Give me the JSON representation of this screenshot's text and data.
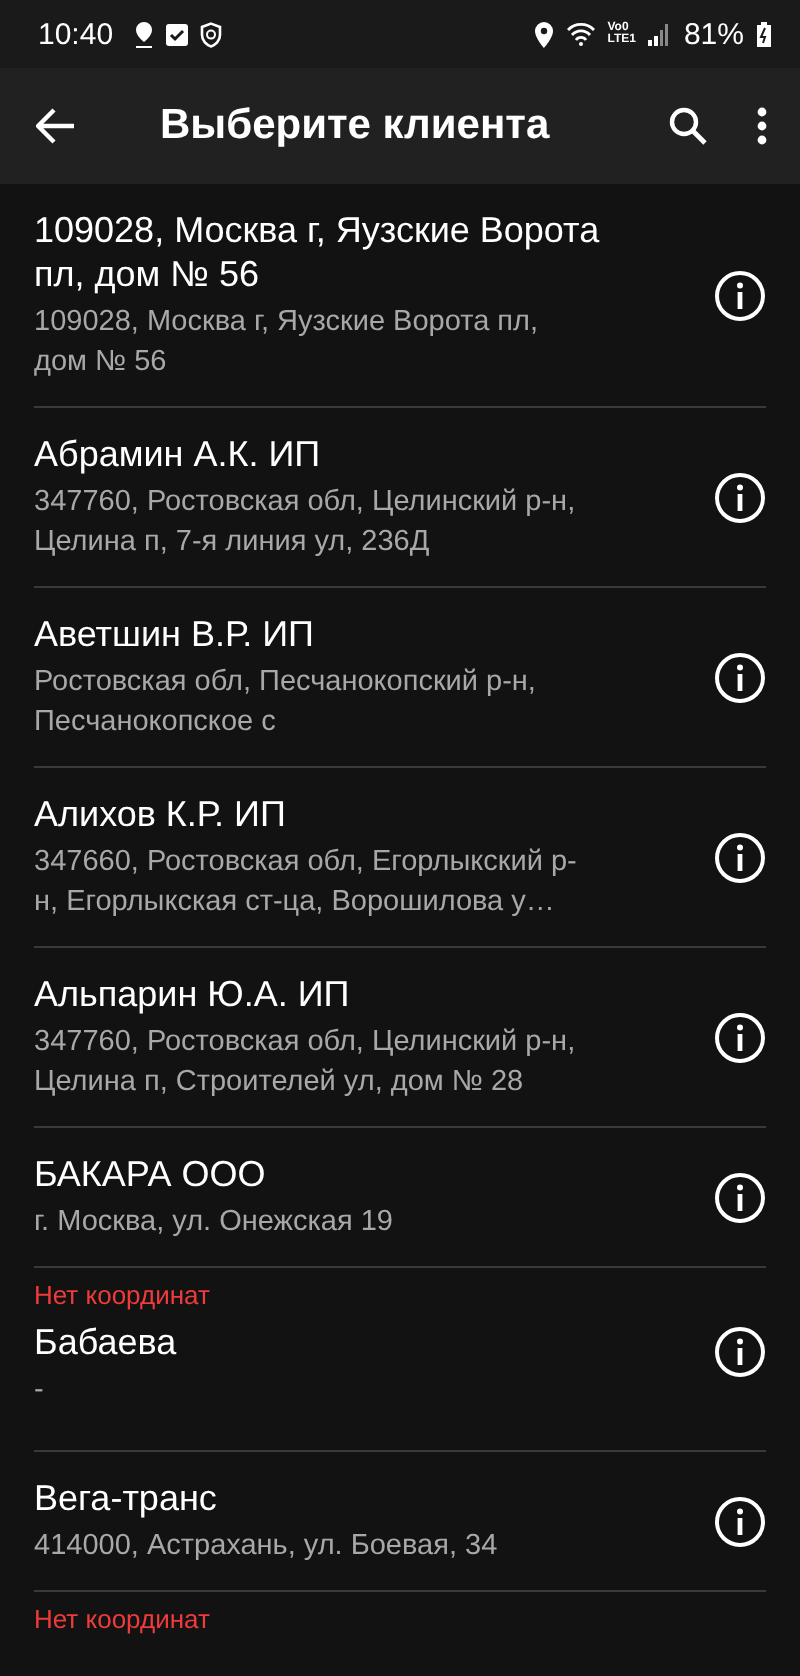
{
  "status_bar": {
    "time": "10:40",
    "network_label_top": "Vo0",
    "network_label_bottom": "LTE1",
    "battery": "81%"
  },
  "toolbar": {
    "title": "Выберите клиента"
  },
  "clients": [
    {
      "name": "109028, Москва г, Яузские Ворота пл, дом № 56",
      "address": "109028, Москва г, Яузские Ворота пл, дом № 56",
      "no_coordinates": false
    },
    {
      "name": "Абрамин А.К. ИП",
      "address": "347760, Ростовская обл, Целинский р-н, Целина п, 7-я линия ул, 236Д",
      "no_coordinates": false
    },
    {
      "name": "Аветшин В.Р. ИП",
      "address": "Ростовская обл, Песчанокопский р-н, Песчанокопское с",
      "no_coordinates": false
    },
    {
      "name": "Алихов К.Р. ИП",
      "address": "347660, Ростовская обл, Егорлыкский р-н, Егорлыкская ст-ца, Ворошилова у…",
      "no_coordinates": false
    },
    {
      "name": "Альпарин Ю.А. ИП",
      "address": "347760, Ростовская обл, Целинский р-н, Целина п, Строителей ул, дом № 28",
      "no_coordinates": false
    },
    {
      "name": "БАКАРА ООО",
      "address": "г. Москва, ул. Онежская 19",
      "no_coordinates": false
    },
    {
      "name": "Бабаева",
      "address": "-",
      "no_coordinates": true,
      "warning": "Нет координат"
    },
    {
      "name": "Вега-транс",
      "address": "414000, Астрахань, ул. Боевая, 34",
      "no_coordinates": false
    },
    {
      "no_coordinates": true,
      "warning": "Нет координат"
    }
  ]
}
